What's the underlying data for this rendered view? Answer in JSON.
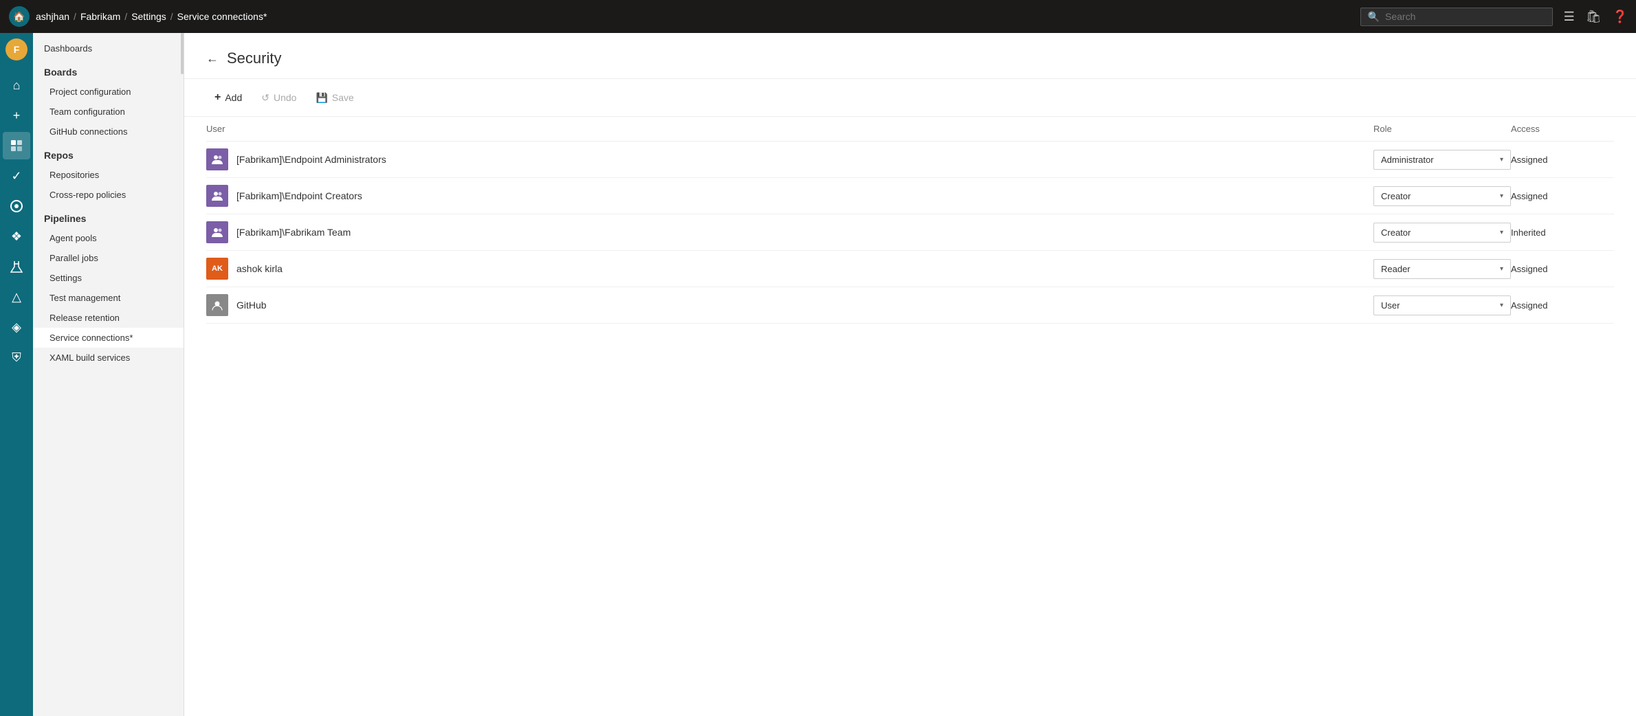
{
  "topbar": {
    "breadcrumbs": [
      {
        "label": "ashjhan"
      },
      {
        "label": "Fabrikam"
      },
      {
        "label": "Settings"
      },
      {
        "label": "Service connections*"
      }
    ],
    "search_placeholder": "Search"
  },
  "sidebar_icons": [
    {
      "name": "home-icon",
      "symbol": "⌂"
    },
    {
      "name": "plus-icon",
      "symbol": "+"
    },
    {
      "name": "board-icon",
      "symbol": "▦"
    },
    {
      "name": "check-icon",
      "symbol": "✓"
    },
    {
      "name": "repo-icon",
      "symbol": "⊙"
    },
    {
      "name": "puzzle-icon",
      "symbol": "❖"
    },
    {
      "name": "beaker-icon",
      "symbol": "⚗"
    },
    {
      "name": "deploy-icon",
      "symbol": "△"
    },
    {
      "name": "artifact-icon",
      "symbol": "◈"
    },
    {
      "name": "shield-icon",
      "symbol": "⛨"
    }
  ],
  "nav": {
    "top_items": [
      {
        "label": "Dashboards"
      }
    ],
    "sections": [
      {
        "title": "Boards",
        "items": [
          {
            "label": "Project configuration"
          },
          {
            "label": "Team configuration"
          },
          {
            "label": "GitHub connections"
          }
        ]
      },
      {
        "title": "Repos",
        "items": [
          {
            "label": "Repositories"
          },
          {
            "label": "Cross-repo policies"
          }
        ]
      },
      {
        "title": "Pipelines",
        "items": [
          {
            "label": "Agent pools"
          },
          {
            "label": "Parallel jobs"
          },
          {
            "label": "Settings"
          },
          {
            "label": "Test management"
          },
          {
            "label": "Release retention"
          },
          {
            "label": "Service connections*"
          },
          {
            "label": "XAML build services"
          }
        ]
      }
    ]
  },
  "security": {
    "title": "Security",
    "toolbar": {
      "add_label": "Add",
      "undo_label": "Undo",
      "save_label": "Save"
    },
    "table": {
      "col_user": "User",
      "col_role": "Role",
      "col_access": "Access"
    },
    "rows": [
      {
        "name": "[Fabrikam]\\Endpoint Administrators",
        "avatar_type": "group",
        "avatar_text": "👥",
        "role": "Administrator",
        "access": "Assigned"
      },
      {
        "name": "[Fabrikam]\\Endpoint Creators",
        "avatar_type": "group",
        "avatar_text": "👥",
        "role": "Creator",
        "access": "Assigned"
      },
      {
        "name": "[Fabrikam]\\Fabrikam Team",
        "avatar_type": "group",
        "avatar_text": "👥",
        "role": "Creator",
        "access": "Inherited"
      },
      {
        "name": "ashok kirla",
        "avatar_type": "personal",
        "avatar_text": "AK",
        "role": "Reader",
        "access": "Assigned"
      },
      {
        "name": "GitHub",
        "avatar_type": "github",
        "avatar_text": "⊙",
        "role": "User",
        "access": "Assigned"
      }
    ]
  }
}
